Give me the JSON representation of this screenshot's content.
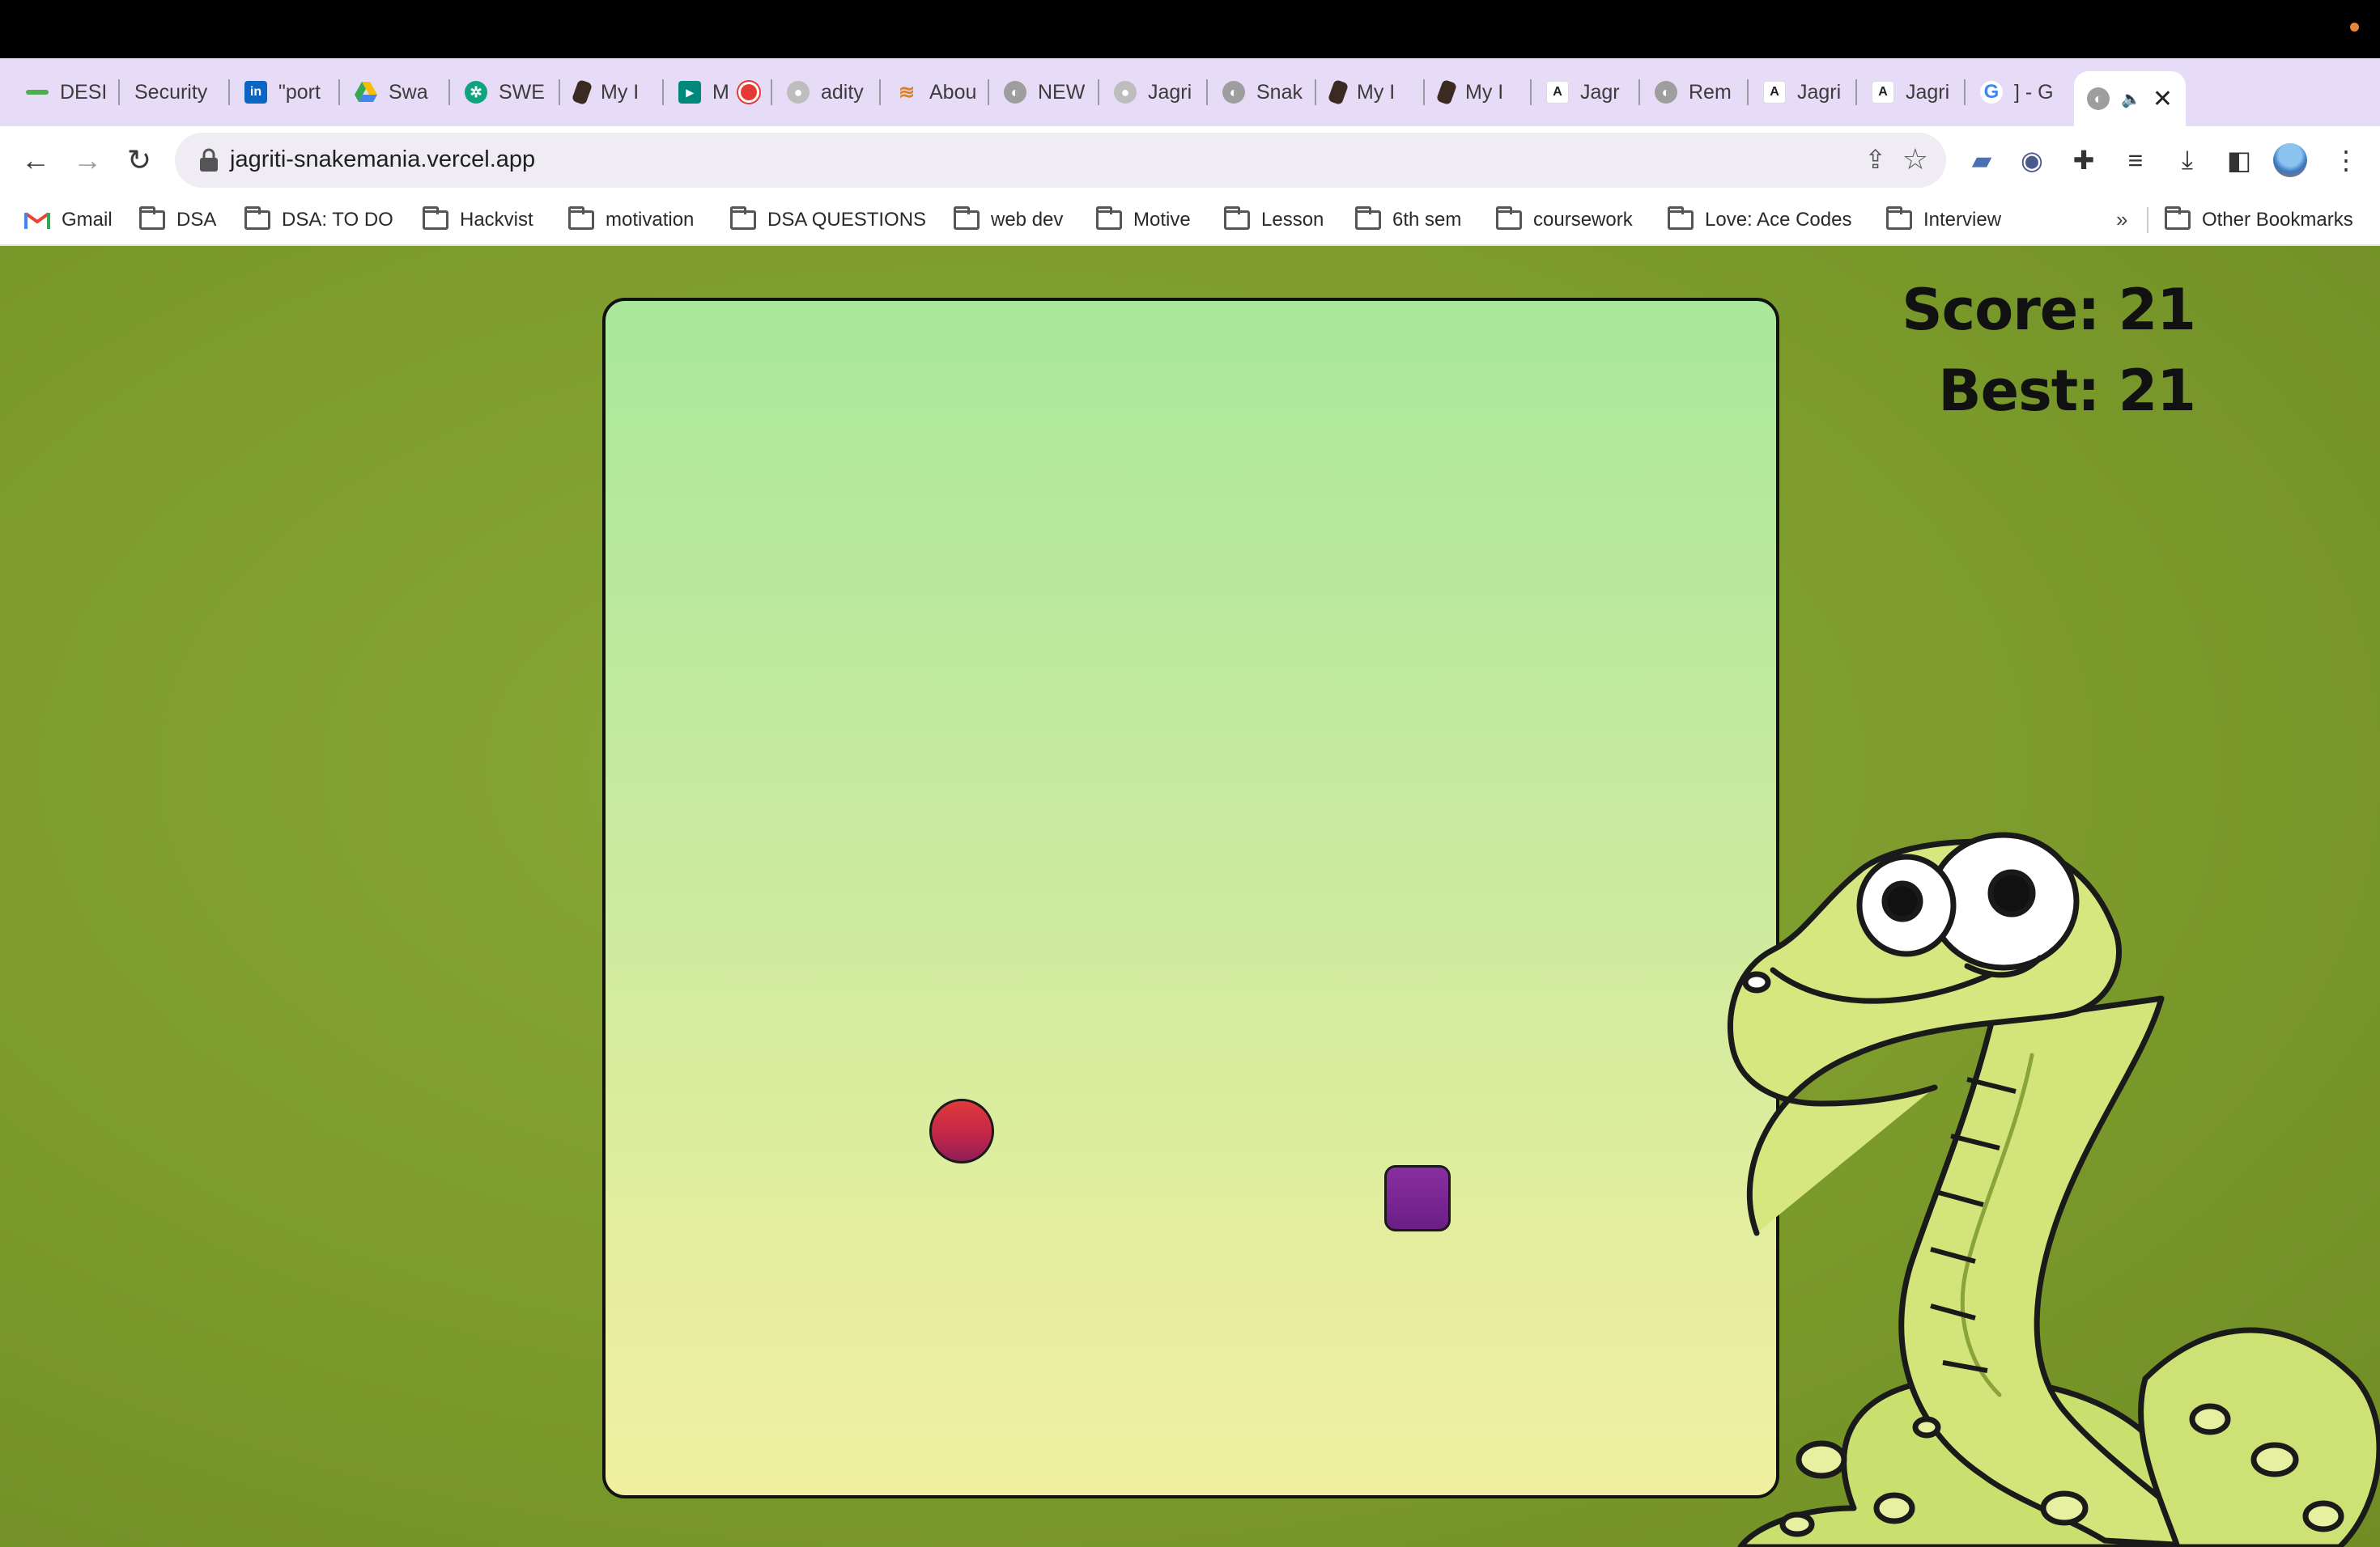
{
  "browser": {
    "tabs": [
      {
        "label": "DESI",
        "icon": "dash-icon",
        "color": "#4caf50"
      },
      {
        "label": "Security",
        "icon": "none",
        "color": "#888888"
      },
      {
        "label": "\"port",
        "icon": "linkedin-icon",
        "color": "#0a66c2"
      },
      {
        "label": "Swa",
        "icon": "drive-icon",
        "color": "#fbbc04"
      },
      {
        "label": "SWE",
        "icon": "openai-icon",
        "color": "#10a37f"
      },
      {
        "label": "My I",
        "icon": "app-icon",
        "color": "#3b2a22"
      },
      {
        "label": "M",
        "icon": "meet-icon",
        "color": "#00897b"
      },
      {
        "label": "adity",
        "icon": "github-icon",
        "color": "#9e9e9e"
      },
      {
        "label": "Abou",
        "icon": "stack-icon",
        "color": "#d9822b"
      },
      {
        "label": "NEW",
        "icon": "globe-icon",
        "color": "#9e9e9e"
      },
      {
        "label": "Jagri",
        "icon": "github-icon",
        "color": "#9e9e9e"
      },
      {
        "label": "Snak",
        "icon": "globe-icon",
        "color": "#9e9e9e"
      },
      {
        "label": "My I",
        "icon": "app-icon",
        "color": "#3b2a22"
      },
      {
        "label": "My I",
        "icon": "app-icon",
        "color": "#3b2a22"
      },
      {
        "label": "Jagr",
        "icon": "a-icon",
        "color": "#222222"
      },
      {
        "label": "Rem",
        "icon": "globe-icon",
        "color": "#9e9e9e"
      },
      {
        "label": "Jagri",
        "icon": "a-icon",
        "color": "#222222"
      },
      {
        "label": "Jagri",
        "icon": "a-icon",
        "color": "#222222"
      },
      {
        "label": "] - G",
        "icon": "google-icon",
        "color": "#4285f4"
      }
    ],
    "url": "jagriti-snakemania.vercel.app",
    "bookmarks": [
      {
        "label": "Gmail",
        "icon": "gmail-icon"
      },
      {
        "label": "DSA",
        "icon": "folder-icon"
      },
      {
        "label": "DSA: TO DO",
        "icon": "folder-icon"
      },
      {
        "label": "Hackvist",
        "icon": "folder-icon"
      },
      {
        "label": "motivation",
        "icon": "folder-icon"
      },
      {
        "label": "DSA QUESTIONS",
        "icon": "folder-icon"
      },
      {
        "label": "web dev",
        "icon": "folder-icon"
      },
      {
        "label": "Motive",
        "icon": "folder-icon"
      },
      {
        "label": "Lesson",
        "icon": "folder-icon"
      },
      {
        "label": "6th sem",
        "icon": "folder-icon"
      },
      {
        "label": "coursework",
        "icon": "folder-icon"
      },
      {
        "label": "Love: Ace Codes",
        "icon": "folder-icon"
      },
      {
        "label": "Interview",
        "icon": "folder-icon"
      }
    ],
    "more_bookmarks": "»",
    "other_bookmarks": "Other Bookmarks"
  },
  "game": {
    "score_text": "Score: 21",
    "best_text": "Best: 21",
    "colors": {
      "background": "#7c9b2c",
      "board_top": "#a9e89c",
      "board_bottom": "#f0f0a0",
      "food": "#c0254a",
      "snake": "#6a1f86"
    }
  }
}
